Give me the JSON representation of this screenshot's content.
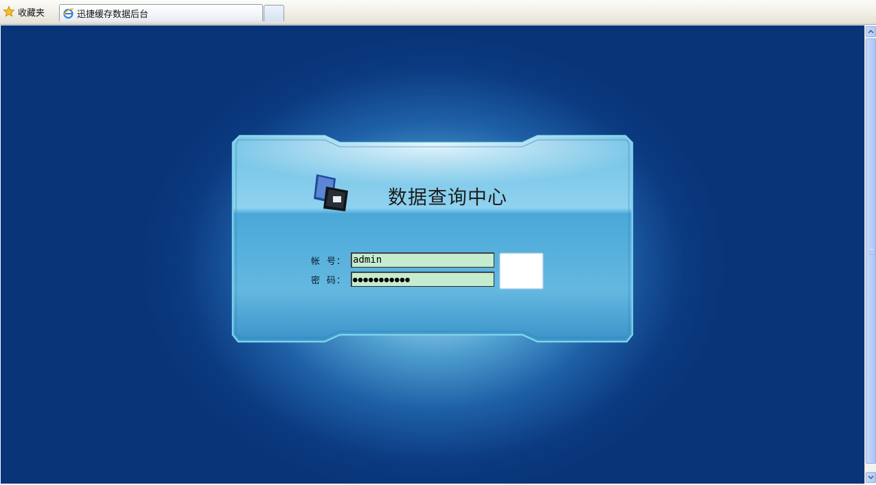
{
  "browser": {
    "favorites_label": "收藏夹",
    "tab_title": "迅捷缓存数据后台"
  },
  "login": {
    "title": "数据查询中心",
    "username_label": "帐 号：",
    "username_value": "admin",
    "password_label": "密 码：",
    "password_mask": "●●●●●●●●●●●"
  },
  "colors": {
    "background_dark": "#0a3478",
    "background_glow": "#9fd3ec",
    "panel_border": "#7fd3ea",
    "field_bg": "#c6eccf"
  },
  "icons": {
    "favorites": "star-icon",
    "tab": "ie-logo-icon",
    "brand": "monitor-logo-icon"
  }
}
